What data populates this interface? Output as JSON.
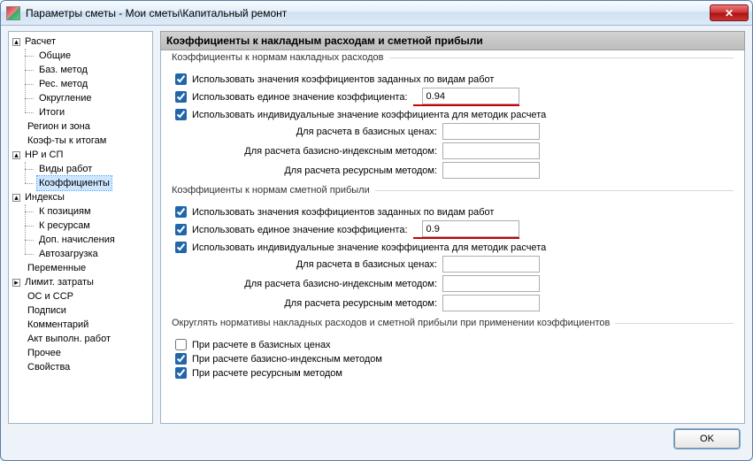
{
  "window": {
    "title": "Параметры сметы - Мои сметы\\Капитальный ремонт"
  },
  "tree": {
    "raschet": "Расчет",
    "obshchie": "Общие",
    "baz_metod": "Баз. метод",
    "res_metod": "Рес. метод",
    "okruglenie": "Округление",
    "itogi": "Итоги",
    "region_zona": "Регион и зона",
    "koef_itogam": "Коэф-ты к итогам",
    "nr_sp": "НР и СП",
    "vidy_rabot": "Виды работ",
    "koefficienty": "Коэффициенты",
    "indeksy": "Индексы",
    "k_poziciyam": "К позициям",
    "k_resursam": "К ресурсам",
    "dop_nachisleniya": "Доп. начисления",
    "avtozagruzka": "Автозагрузка",
    "peremennye": "Переменные",
    "limit_zatraty": "Лимит. затраты",
    "os_ssr": "ОС и ССР",
    "podpisi": "Подписи",
    "kommentarii": "Комментарий",
    "akt_vypoln": "Акт выполн. работ",
    "prochee": "Прочее",
    "svoistva": "Свойства"
  },
  "panel": {
    "header": "Коэффициенты к накладным расходам и сметной прибыли",
    "group1_title": "Коэффициенты к нормам накладных расходов",
    "group2_title": "Коэффициенты к нормам сметной прибыли",
    "use_by_work_types": "Использовать значения коэффициентов заданных по видам работ",
    "use_single_value": "Использовать единое значение коэффициента:",
    "use_individual": "Использовать индивидуальные значение коэффициента для методик расчета",
    "calc_basic": "Для расчета в базисных ценах:",
    "calc_basic_index": "Для расчета базисно-индексным методом:",
    "calc_resource": "Для расчета ресурсным методом:",
    "nr_single_value": "0.94",
    "sp_single_value": "0.9",
    "nr_basic": "",
    "nr_basic_index": "",
    "nr_resource": "",
    "sp_basic": "",
    "sp_basic_index": "",
    "sp_resource": "",
    "rounding_title": "Округлять нормативы накладных расходов и сметной прибыли при применении коэффициентов",
    "round_basic": "При расчете в базисных ценах",
    "round_basic_index": "При расчете базисно-индексным методом",
    "round_resource": "При расчете ресурсным методом"
  },
  "buttons": {
    "ok": "OK"
  }
}
